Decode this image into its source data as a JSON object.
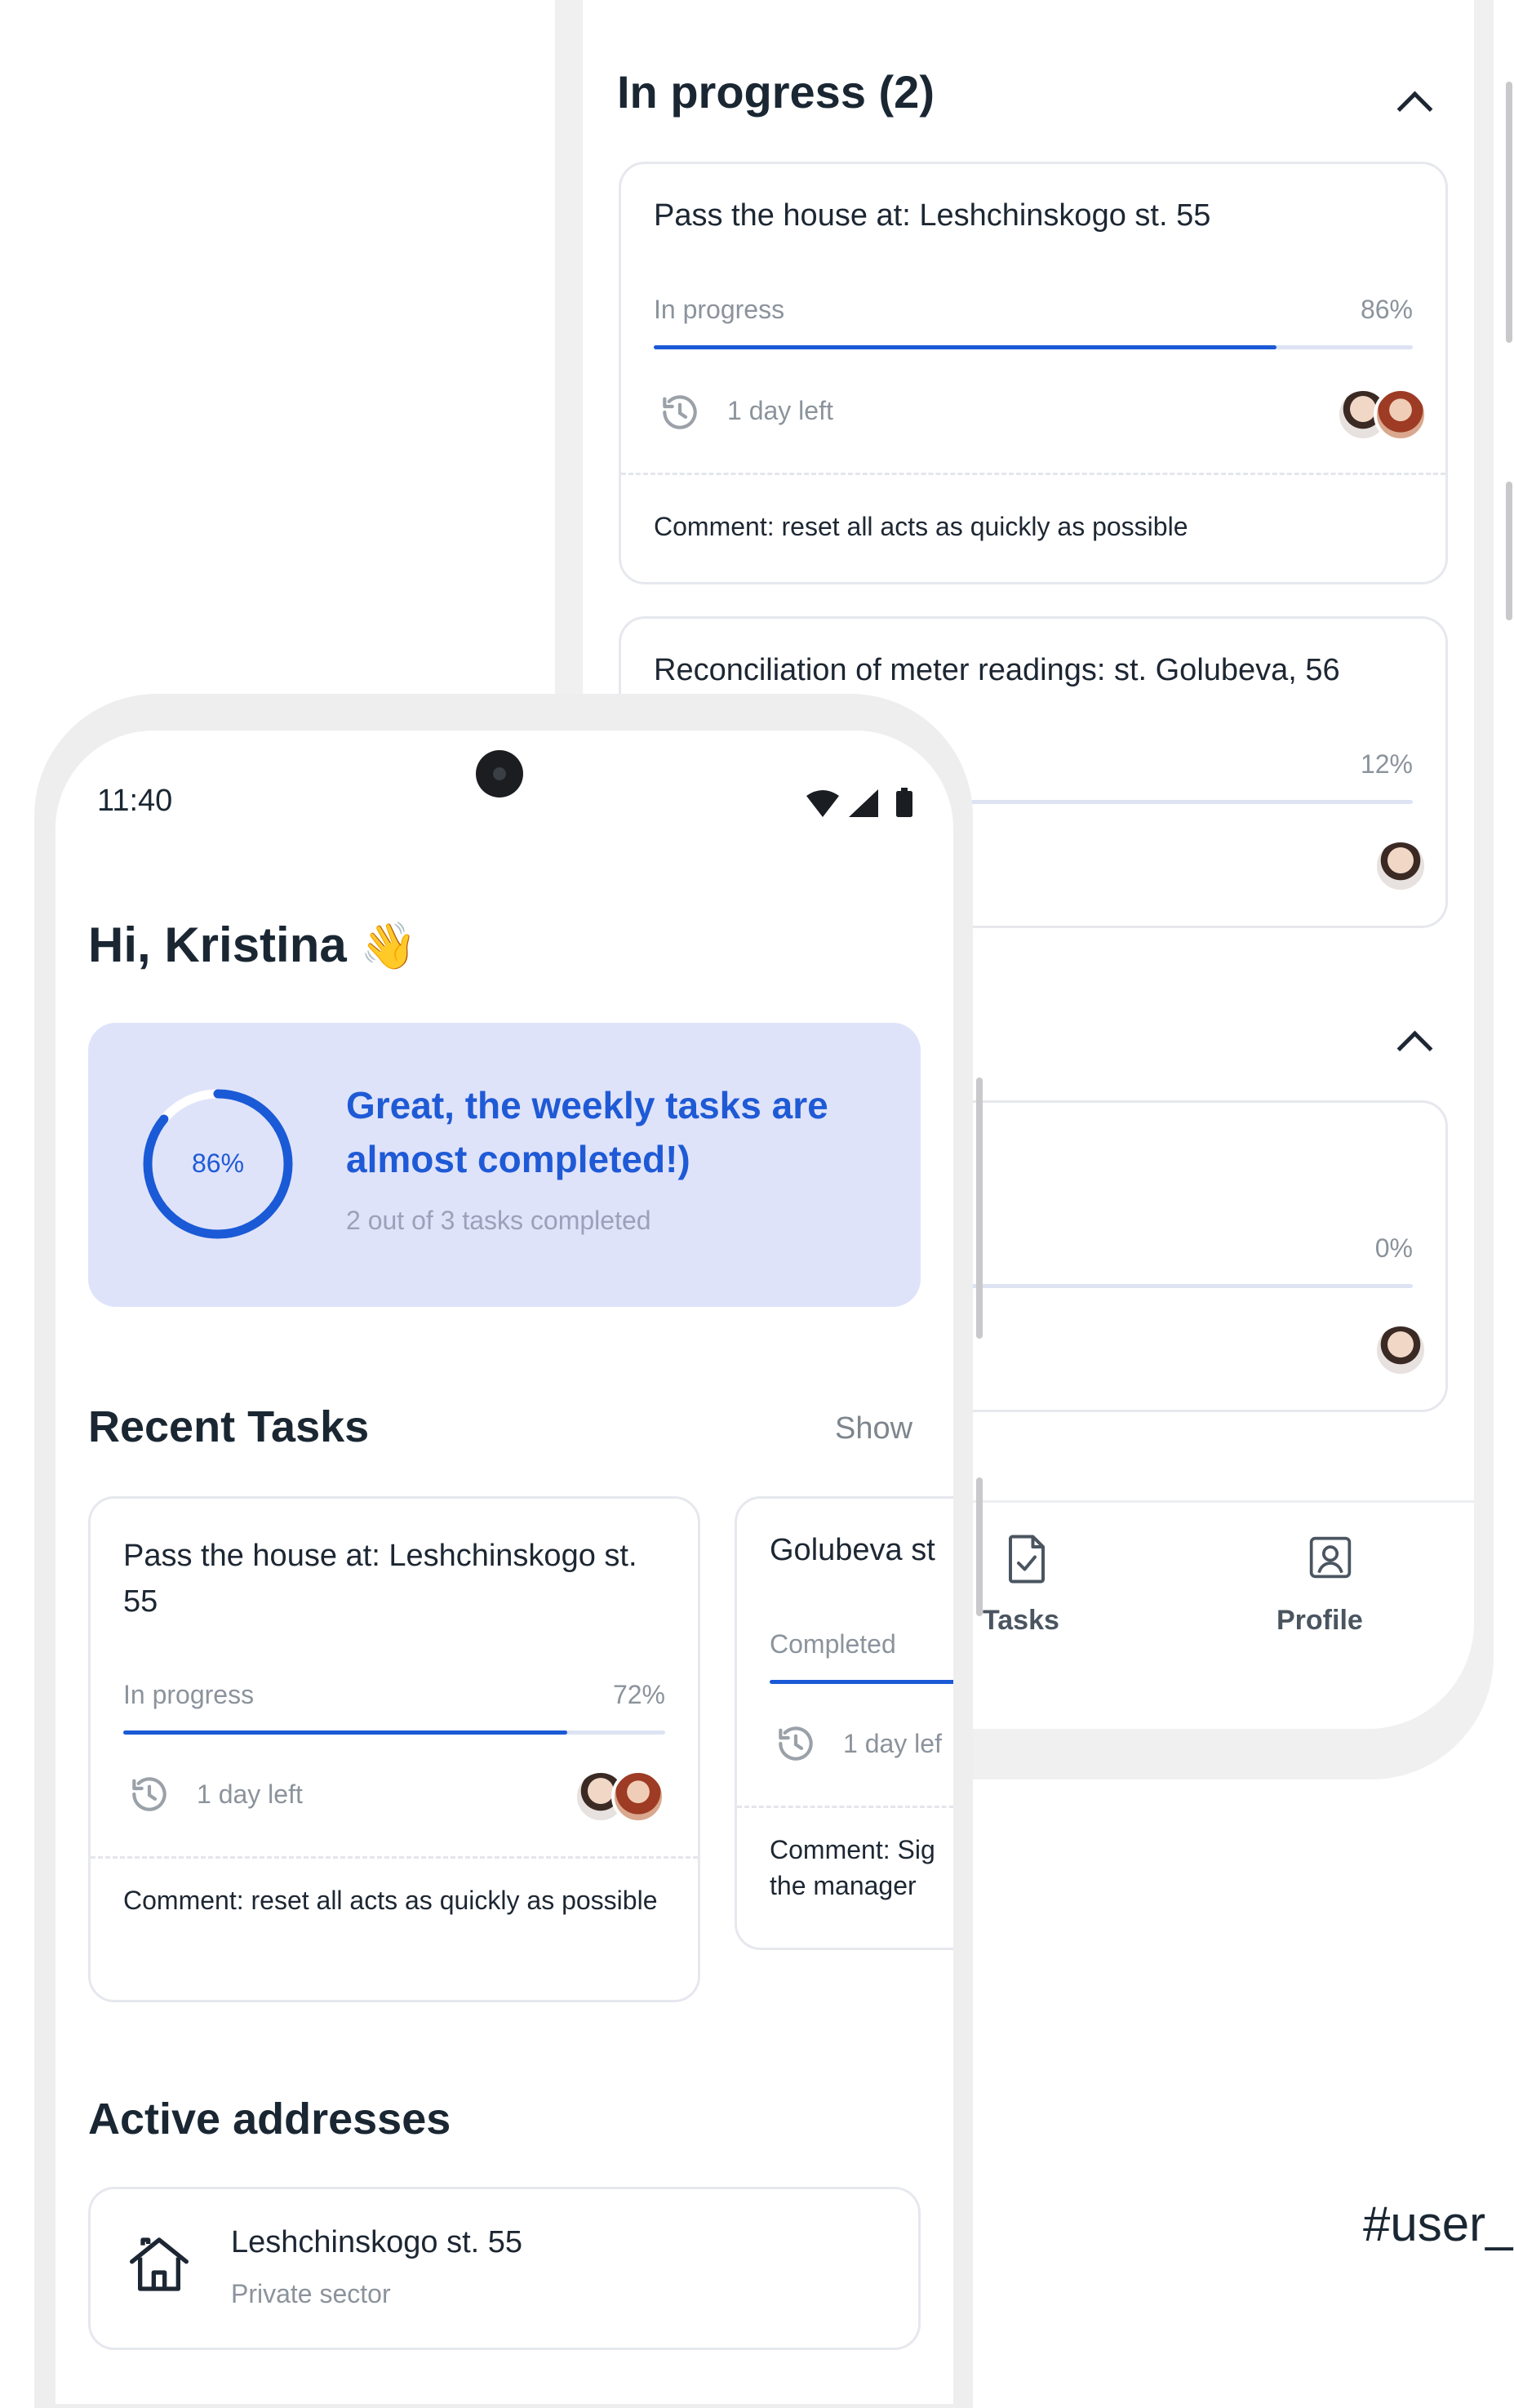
{
  "back_screen": {
    "in_progress_header": "In progress (2)",
    "tasks": [
      {
        "title": "Pass the house at: Leshchinskogo st. 55",
        "status": "In progress",
        "percent_label": "86%",
        "progress": 0.82,
        "time_left": "1 day left",
        "comment": "Comment: reset all acts as quickly as possible"
      },
      {
        "title": "Reconciliation of meter readings: st. Golubeva, 56",
        "percent_label": "12%",
        "progress": 0.12
      }
    ],
    "third_card_percent": "0%",
    "bottom_nav": {
      "tasks_label": "Tasks",
      "profile_label": "Profile"
    }
  },
  "front_screen": {
    "status_bar": {
      "time": "11:40"
    },
    "greeting": "Hi, Kristina",
    "greeting_emoji": "👋",
    "summary": {
      "percent_label": "86%",
      "progress": 0.86,
      "title": "Great, the weekly tasks are almost completed!)",
      "subtitle": "2 out of 3 tasks completed"
    },
    "recent_tasks": {
      "heading": "Recent Tasks",
      "show_label": "Show",
      "cards": [
        {
          "title": "Pass the house at: Leshchinskogo st. 55",
          "status": "In progress",
          "percent_label": "72%",
          "progress": 0.82,
          "time_left": "1 day left",
          "comment": "Comment: reset all acts as quickly as possible"
        },
        {
          "title": "Golubeva st",
          "status": "Completed",
          "time_left": "1 day lef",
          "comment": "Comment: Sig the manager"
        }
      ]
    },
    "active_addresses": {
      "heading": "Active addresses",
      "items": [
        {
          "name": "Leshchinskogo st. 55",
          "type": "Private sector"
        }
      ]
    }
  },
  "hashtag": "#user_",
  "colors": {
    "accent": "#1a5ad6",
    "hero_bg": "#dfe3fa"
  }
}
